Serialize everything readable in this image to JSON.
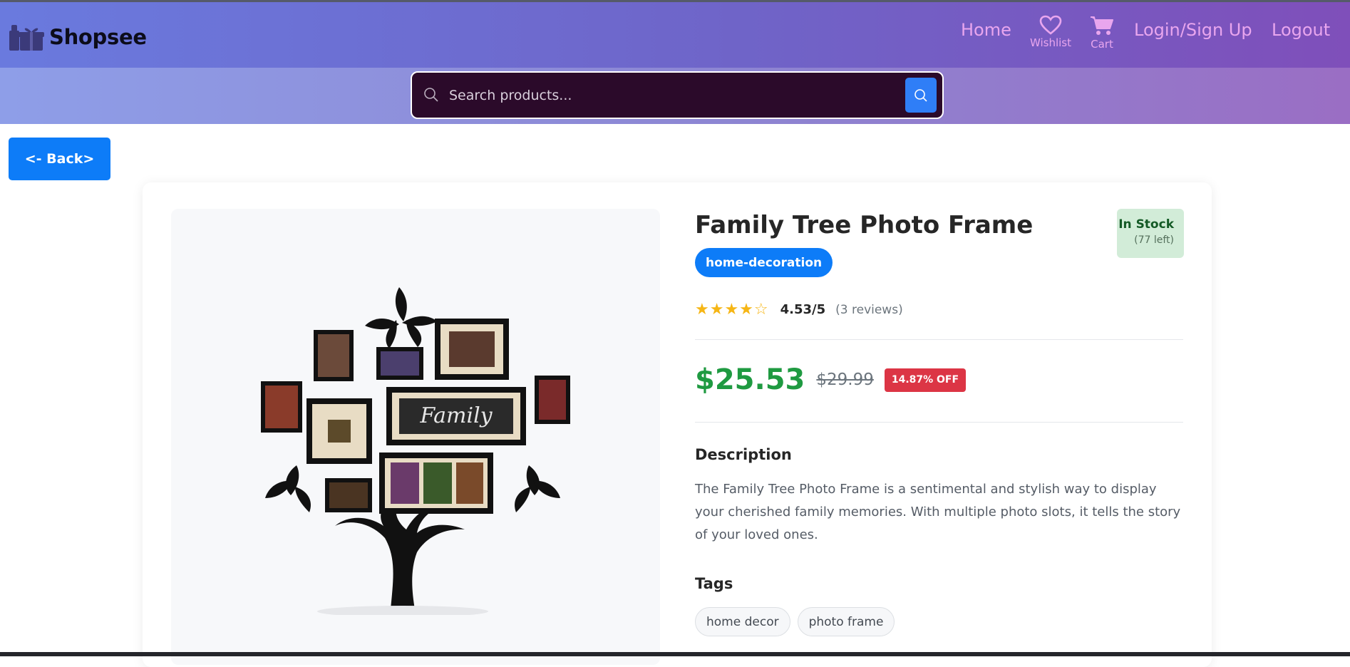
{
  "app": {
    "name": "Shopsee"
  },
  "nav": {
    "home": "Home",
    "wishlist": "Wishlist",
    "cart": "Cart",
    "login": "Login/Sign Up",
    "logout": "Logout"
  },
  "search": {
    "placeholder": "Search products...",
    "value": ""
  },
  "back_label": "<- Back>",
  "product": {
    "title": "Family Tree Photo Frame",
    "category": "home-decoration",
    "stock_status": "In Stock",
    "stock_left": "(77 left)",
    "rating": 4.53,
    "rating_text": "4.53/5",
    "stars_display": "★★★★☆",
    "reviews": "(3 reviews)",
    "price": "$25.53",
    "original_price": "$29.99",
    "discount": "14.87% OFF",
    "image_label": "Family",
    "description_heading": "Description",
    "description": "The Family Tree Photo Frame is a sentimental and stylish way to display your cherished family memories. With multiple photo slots, it tells the story of your loved ones.",
    "tags_heading": "Tags",
    "tags": [
      "home decor",
      "photo frame"
    ]
  },
  "colors": {
    "nav_gradient_start": "#6a7ade",
    "nav_gradient_end": "#7f4fba",
    "nav_link": "#e9a6ee",
    "primary": "#0d7cf8",
    "price": "#1f9a41",
    "discount": "#dc3545",
    "stars": "#f6b615",
    "stock_bg": "#d2ecd8"
  },
  "icons": {
    "brand": "gift-boxes-icon",
    "wishlist": "heart-icon",
    "cart": "cart-icon",
    "search": "search-icon"
  }
}
